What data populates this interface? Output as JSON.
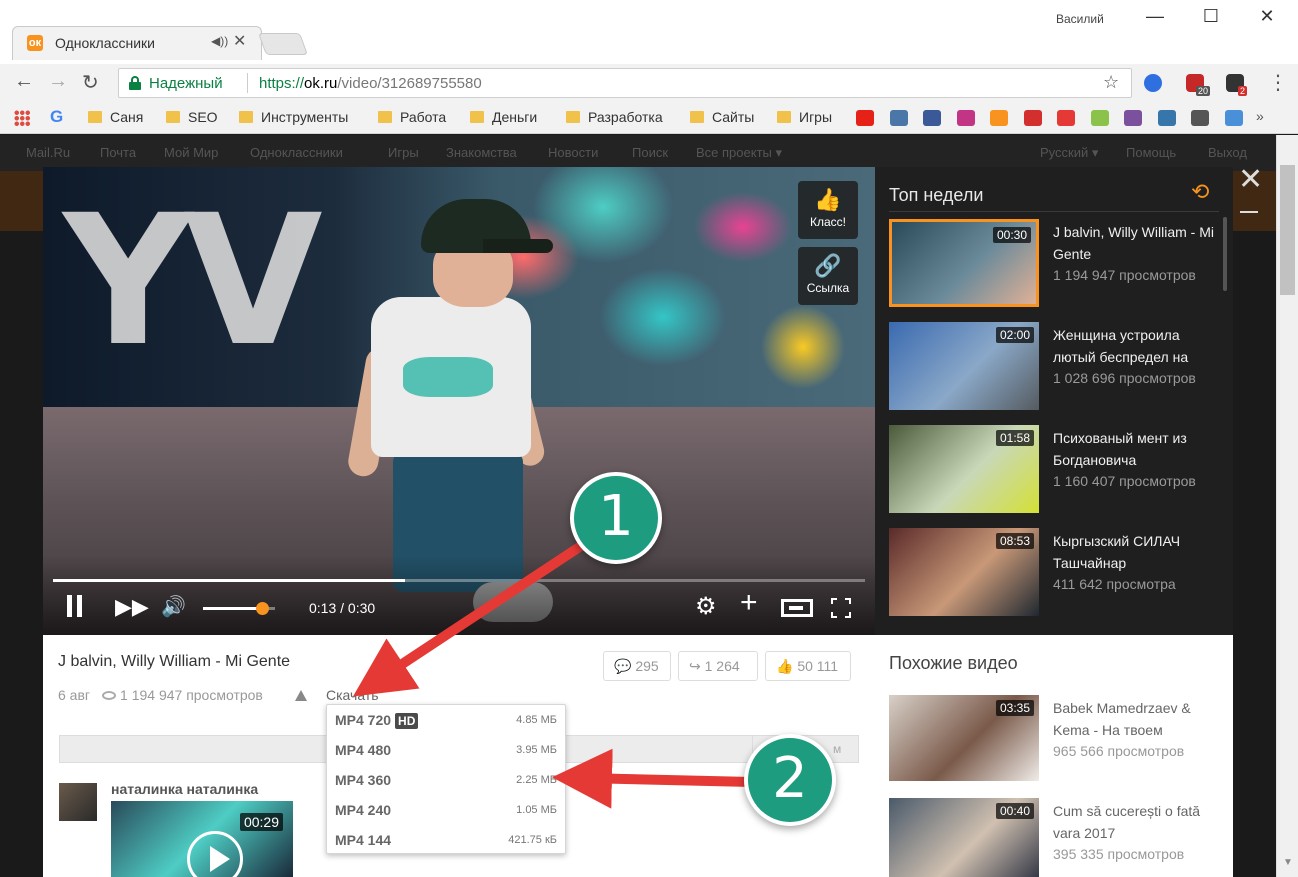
{
  "window": {
    "user_name": "Василий",
    "minimize_glyph": "—",
    "maximize_glyph": "☐",
    "close_glyph": "✕"
  },
  "tabs": [
    {
      "favicon": "ok",
      "title": "Одноклассники",
      "audio_glyph": "◀))",
      "close_glyph": "✕"
    }
  ],
  "toolbar": {
    "back_glyph": "←",
    "forward_glyph": "→",
    "reload_glyph": "↻",
    "secure_label": "Надежный",
    "url_scheme": "https://",
    "url_host": "ok.ru",
    "url_path": "/video/312689755580",
    "star_glyph": "☆",
    "extension_badges": [
      "20",
      "2"
    ],
    "menu_glyph": "⋮"
  },
  "bookmarks": {
    "google_glyph": "G",
    "folders": [
      "Саня",
      "SEO",
      "Инструменты",
      "Работа",
      "Деньги",
      "Разработка",
      "Сайты",
      "Игры"
    ],
    "icons": [
      {
        "name": "youtube-icon",
        "color": "#e62117"
      },
      {
        "name": "vk-icon",
        "color": "#4a76a8"
      },
      {
        "name": "facebook-icon",
        "color": "#3b5998"
      },
      {
        "name": "instagram-icon",
        "color": "#c13584"
      },
      {
        "name": "odnoklassniki-icon",
        "color": "#f7931e"
      },
      {
        "name": "home-icon",
        "color": "#d32f2f"
      },
      {
        "name": "plus-icon",
        "color": "#e53935"
      },
      {
        "name": "android-icon",
        "color": "#8bc34a"
      },
      {
        "name": "viber-icon",
        "color": "#7b519d"
      },
      {
        "name": "python-icon",
        "color": "#3776ab"
      },
      {
        "name": "olx-icon",
        "color": "#555555"
      },
      {
        "name": "storage-icon",
        "color": "#4a90d9"
      }
    ],
    "more_glyph": "»"
  },
  "portal_bar": {
    "links": [
      "Mail.Ru",
      "Почта",
      "Мой Мир",
      "Одноклассники",
      "Игры",
      "Знакомства",
      "Новости",
      "Поиск",
      "Все проекты ▾"
    ],
    "right_links": [
      "Русский ▾",
      "Помощь",
      "Выход"
    ]
  },
  "player": {
    "side_buttons": [
      {
        "glyph": "👍",
        "label": "Класс!"
      },
      {
        "glyph": "🔗",
        "label": "Ссылка"
      }
    ],
    "progress": 0.433,
    "volume": 0.82,
    "time": "0:13 / 0:30",
    "next_glyph": "▶▶",
    "volume_glyph": "🔊",
    "settings_glyph": "⚙",
    "add_glyph": "+",
    "scene_letters": "YV"
  },
  "layer": {
    "close_glyph": "✕"
  },
  "top_week": {
    "title": "Топ недели",
    "refresh_glyph": "⟲",
    "items": [
      {
        "duration": "00:30",
        "title": "J balvin, Willy William - Mi Gente",
        "views": "1 194 947 просмотров",
        "active": true,
        "colors": [
          "#2a4a5a",
          "#6a8a9a",
          "#e0b197"
        ]
      },
      {
        "duration": "02:00",
        "title": "Женщина устроила лютый беспредел на",
        "views": "1 028 696 просмотров",
        "active": false,
        "colors": [
          "#3a6ab0",
          "#8aa8c8",
          "#555b60"
        ]
      },
      {
        "duration": "01:58",
        "title": "Психованый мент из Богдановича",
        "views": "1 160 407 просмотров",
        "active": false,
        "colors": [
          "#4a5a3a",
          "#c8d8b8",
          "#d4e034"
        ]
      },
      {
        "duration": "08:53",
        "title": "Кыргызский СИЛАЧ Ташчайнар",
        "views": "411 642 просмотра",
        "active": false,
        "colors": [
          "#5a2a2a",
          "#c89878",
          "#202830"
        ]
      }
    ]
  },
  "video": {
    "title": "J balvin, Willy William - Mi Gente",
    "date": "6 авг",
    "views": "1 194 947 просмотров",
    "download_label": "Скачать",
    "comments_count": "295",
    "shares_count": "1 264",
    "likes_count": "50 111",
    "comments_glyph": "💬",
    "shares_glyph": "↪",
    "likes_glyph": "👍",
    "comment_bar_right": "м"
  },
  "comment": {
    "author": "наталинка наталинка",
    "thumb_duration": "00:29"
  },
  "similar": {
    "title": "Похожие видео",
    "items": [
      {
        "duration": "03:35",
        "title": "Babek Mamedrzaev & Kema - На твоем",
        "views": "965 566 просмотров",
        "colors": [
          "#d8d0c8",
          "#7a5a4a",
          "#f0ece8"
        ]
      },
      {
        "duration": "00:40",
        "title": "Cum să cucerești o fată vara 2017",
        "views": "395 335 просмотров",
        "colors": [
          "#4a5a6a",
          "#d0c0b0",
          "#2a3040"
        ]
      }
    ]
  },
  "download_menu": {
    "options": [
      {
        "format": "MP4 720",
        "hd": "HD",
        "size": "4.85 МБ"
      },
      {
        "format": "MP4 480",
        "hd": "",
        "size": "3.95 МБ"
      },
      {
        "format": "MP4 360",
        "hd": "",
        "size": "2.25 МБ"
      },
      {
        "format": "MP4 240",
        "hd": "",
        "size": "1.05 МБ"
      },
      {
        "format": "MP4 144",
        "hd": "",
        "size": "421.75 кБ"
      }
    ]
  },
  "annotations": {
    "step_1": "1",
    "step_2": "2",
    "color": "#1e9c7f",
    "arrow_color": "#e53935"
  }
}
